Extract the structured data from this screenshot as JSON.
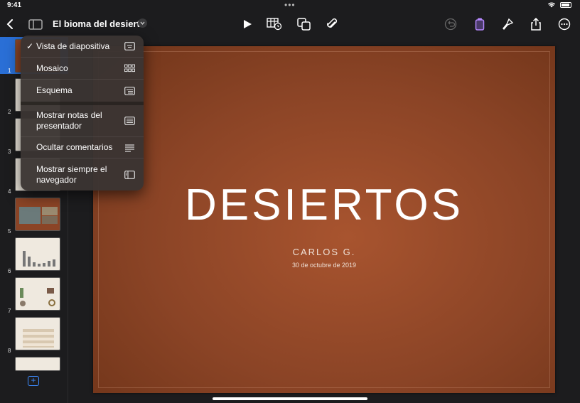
{
  "status": {
    "time": "9:41",
    "dots": "•••"
  },
  "toolbar": {
    "title": "El bioma del desierto",
    "icons": [
      "back-icon",
      "sidebar-icon",
      "chevron-down-icon",
      "play-icon",
      "table-icon",
      "shapes-icon",
      "attachment-icon",
      "undo-icon",
      "format-icon",
      "brush-icon",
      "share-icon",
      "more-icon"
    ],
    "accent": "#b688ff"
  },
  "menu": {
    "items": [
      {
        "label": "Vista de diapositiva",
        "checked": "✓",
        "icon": "slide-view-icon"
      },
      {
        "label": "Mosaico",
        "icon": "grid-icon"
      },
      {
        "label": "Esquema",
        "icon": "outline-icon"
      },
      {
        "label": "Mostrar notas del presentador",
        "icon": "notes-icon"
      },
      {
        "label": "Ocultar comentarios",
        "icon": "comments-icon"
      },
      {
        "label": "Mostrar siempre el navegador",
        "icon": "navigator-icon"
      }
    ]
  },
  "navigator": {
    "thumbnails": [
      {
        "number": "1"
      },
      {
        "number": "2"
      },
      {
        "number": "3"
      },
      {
        "number": "4"
      },
      {
        "number": "5"
      },
      {
        "number": "6"
      },
      {
        "number": "7"
      },
      {
        "number": "8"
      }
    ],
    "add_label": "+"
  },
  "slide": {
    "title": "DESIERTOS",
    "author": "CARLOS G.",
    "date": "30 de octubre de 2019"
  },
  "colors": {
    "selection": "#2a6fd6",
    "slide_bg": "#8b4426",
    "accent_blue": "#3d8bff"
  }
}
